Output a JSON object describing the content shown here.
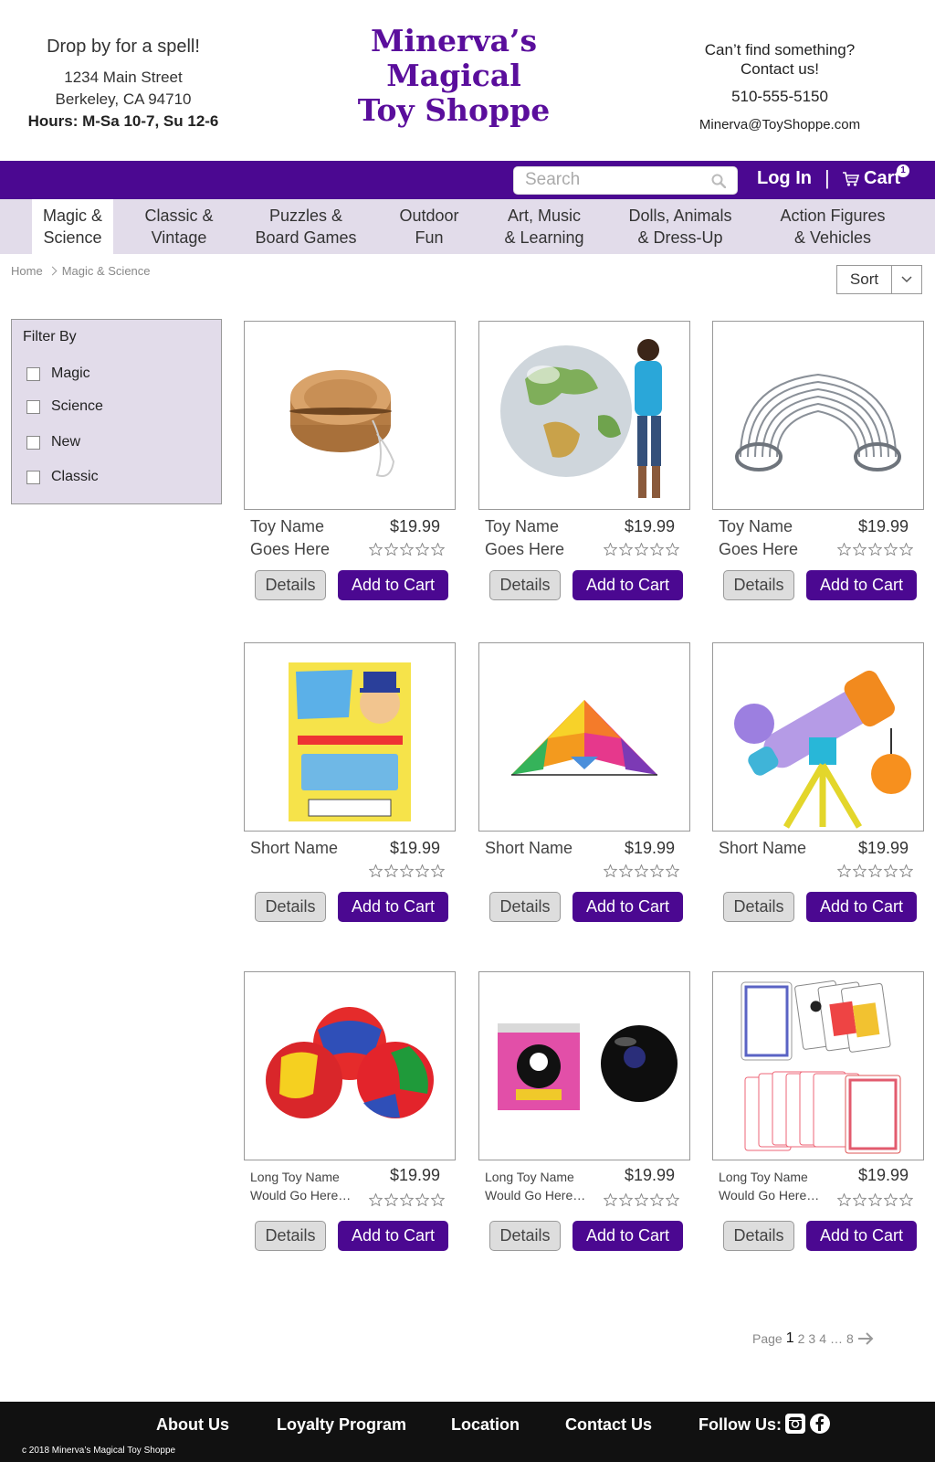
{
  "header": {
    "tagline": "Drop by for a spell!",
    "address_line1": "1234 Main Street",
    "address_line2": "Berkeley, CA 94710",
    "hours": "Hours: M-Sa 10-7, Su 12-6",
    "logo_line1": "Minerva’s",
    "logo_line2": "Magical",
    "logo_line3": "Toy Shoppe",
    "contact_line1": "Can’t find something?",
    "contact_line2": "Contact us!",
    "phone": "510-555-5150",
    "email": "Minerva@ToyShoppe.com"
  },
  "topbar": {
    "search_placeholder": "Search",
    "login": "Log In",
    "divider": "|",
    "cart": "Cart",
    "cart_count": "1"
  },
  "categories": [
    {
      "line1": "Magic &",
      "line2": "Science"
    },
    {
      "line1": "Classic &",
      "line2": "Vintage"
    },
    {
      "line1": "Puzzles &",
      "line2": "Board Games"
    },
    {
      "line1": "Outdoor",
      "line2": "Fun"
    },
    {
      "line1": "Art, Music",
      "line2": "& Learning"
    },
    {
      "line1": "Dolls, Animals",
      "line2": "& Dress-Up"
    },
    {
      "line1": "Action Figures",
      "line2": "& Vehicles"
    }
  ],
  "breadcrumb": {
    "home": "Home",
    "current": "Magic & Science"
  },
  "sort": {
    "label": "Sort"
  },
  "filter": {
    "title": "Filter By",
    "options": [
      "Magic",
      "Science",
      "New",
      "Classic"
    ]
  },
  "products": [
    {
      "name1": "Toy Name",
      "name2": "Goes Here",
      "price": "$19.99",
      "image": "yo-yo"
    },
    {
      "name1": "Toy Name",
      "name2": "Goes Here",
      "price": "$19.99",
      "image": "inflatable-globe"
    },
    {
      "name1": "Toy Name",
      "name2": "Goes Here",
      "price": "$19.99",
      "image": "slinky"
    },
    {
      "name1": "Short Name",
      "name2": "",
      "price": "$19.99",
      "image": "party-magic-tricks"
    },
    {
      "name1": "Short Name",
      "name2": "",
      "price": "$19.99",
      "image": "kite"
    },
    {
      "name1": "Short Name",
      "name2": "",
      "price": "$19.99",
      "image": "toy-telescope"
    },
    {
      "name1": "Long Toy Name",
      "name2": "Would Go Here…",
      "price": "$19.99",
      "image": "juggling-balls"
    },
    {
      "name1": "Long Toy Name",
      "name2": "Would Go Here…",
      "price": "$19.99",
      "image": "magic-8-ball"
    },
    {
      "name1": "Long Toy Name",
      "name2": "Would Go Here…",
      "price": "$19.99",
      "image": "playing-cards"
    }
  ],
  "buttons": {
    "details": "Details",
    "add_to_cart": "Add to Cart"
  },
  "pagination": {
    "label": "Page",
    "current": "1",
    "p2": "2",
    "p3": "3",
    "p4": "4",
    "ellipsis": "…",
    "last": "8"
  },
  "footer": {
    "about": "About Us",
    "loyalty": "Loyalty Program",
    "location": "Location",
    "contact": "Contact Us",
    "follow": "Follow Us:",
    "copyright": "c 2018 Minerva’s Magical Toy Shoppe"
  },
  "colors": {
    "brand_purple": "#4b0891",
    "nav_lavender": "#e2dcea",
    "footer": "#111111"
  }
}
